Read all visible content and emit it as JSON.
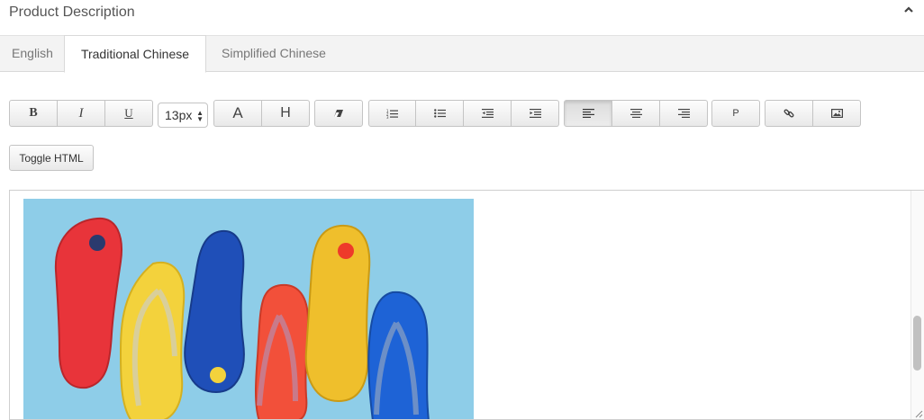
{
  "panel": {
    "title": "Product Description",
    "collapse_icon": "chevron-up-icon"
  },
  "tabs": [
    {
      "label": "English",
      "active": false
    },
    {
      "label": "Traditional Chinese",
      "active": true
    },
    {
      "label": "Simplified Chinese",
      "active": false
    }
  ],
  "toolbar": {
    "bold": "B",
    "italic": "I",
    "underline": "U",
    "font_size": "13px",
    "font_color": "A",
    "highlight": "H",
    "paragraph": "P",
    "icons": {
      "eraser": "eraser-icon",
      "ordered_list": "ordered-list-icon",
      "unordered_list": "unordered-list-icon",
      "outdent": "outdent-icon",
      "indent": "indent-icon",
      "align_left": "align-left-icon",
      "align_center": "align-center-icon",
      "align_right": "align-right-icon",
      "link": "link-icon",
      "image": "image-icon"
    },
    "active_alignment": "left"
  },
  "toggle_html": "Toggle HTML",
  "editor": {
    "content_image": "Colorful flip-flop sandals photo",
    "colors": {
      "background": "#8ecde8",
      "red": "#e8343a",
      "yellow": "#f3d23c",
      "blue": "#1f4fb8",
      "orange_red": "#f2503a",
      "mustard": "#efbf2c",
      "bright_blue": "#1e63d6"
    }
  }
}
